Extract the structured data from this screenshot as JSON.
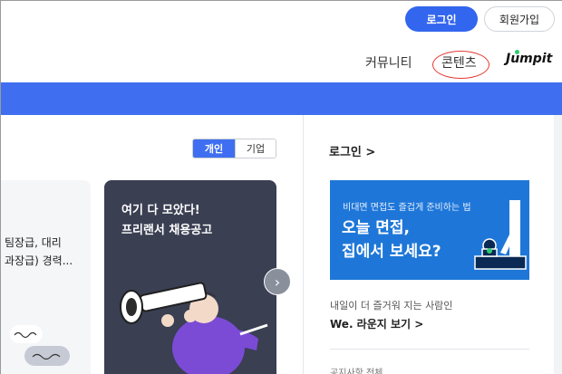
{
  "header": {
    "login_button": "로그인",
    "signup_button": "회원가입",
    "nav": {
      "community": "커뮤니티",
      "contents": "콘텐츠"
    },
    "jumpit_logo": "Jumpit"
  },
  "toggle": {
    "personal": "개인",
    "company": "기업"
  },
  "cards": {
    "left": {
      "line1": "팀장급, 대리",
      "line2": "과장급) 경력..."
    },
    "dark": {
      "line1": "여기 다 모았다!",
      "line2": "프리랜서 채용공고"
    },
    "next_icon": "›"
  },
  "side": {
    "login_link": "로그인 >",
    "ad": {
      "small": "비대면 면접도 즐겁게 준비하는 법",
      "big1": "오늘 면접,",
      "big2": "집에서 보세요?"
    },
    "lounge_sub": "내일이 더 즐거워 지는 사람인",
    "lounge_link": "We. 라운지 보기 >",
    "notice": "공지사항  전체"
  },
  "colors": {
    "accent": "#3f6ff0",
    "dark_card": "#3a3f52",
    "ad_blue": "#1e77d8"
  }
}
